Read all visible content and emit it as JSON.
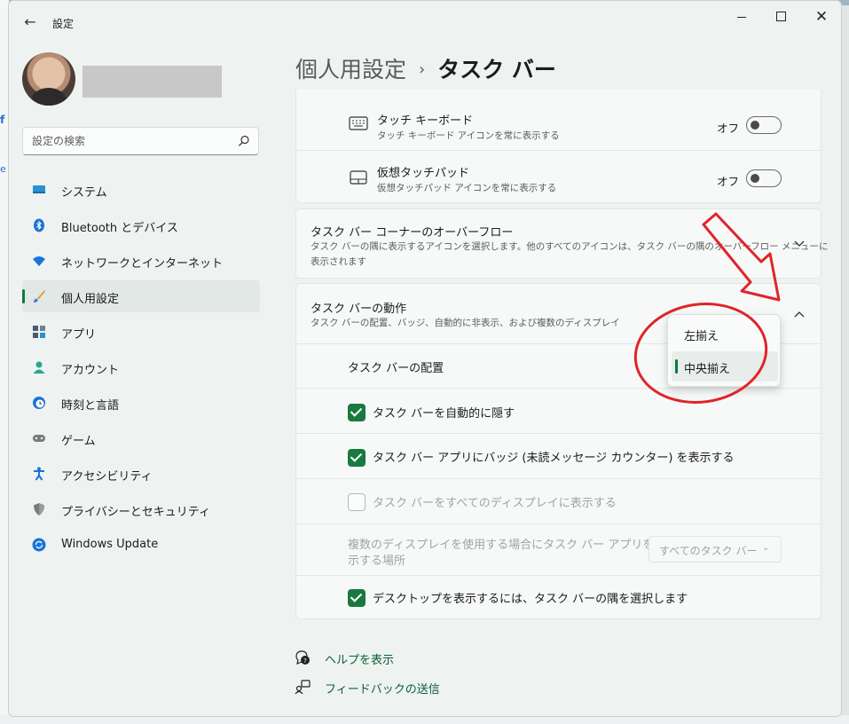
{
  "window": {
    "title": "設定",
    "back_icon": "←",
    "close_icon": "✕"
  },
  "sidebar": {
    "search_placeholder": "設定の検索",
    "items": [
      {
        "label": "システム",
        "icon": "system-icon",
        "color": "#2a8fd4"
      },
      {
        "label": "Bluetooth とデバイス",
        "icon": "bluetooth-icon",
        "color": "#1a73d8"
      },
      {
        "label": "ネットワークとインターネット",
        "icon": "wifi-icon",
        "color": "#1a73d8"
      },
      {
        "label": "個人用設定",
        "icon": "brush-icon",
        "color": "#d9822b",
        "active": true
      },
      {
        "label": "アプリ",
        "icon": "apps-icon",
        "color": "#4a5a70"
      },
      {
        "label": "アカウント",
        "icon": "account-icon",
        "color": "#2ca58d"
      },
      {
        "label": "時刻と言語",
        "icon": "globe-clock-icon",
        "color": "#1a73d8"
      },
      {
        "label": "ゲーム",
        "icon": "gamepad-icon",
        "color": "#6a6a6a"
      },
      {
        "label": "アクセシビリティ",
        "icon": "accessibility-icon",
        "color": "#1a73d8"
      },
      {
        "label": "プライバシーとセキュリティ",
        "icon": "shield-icon",
        "color": "#6a6a6a"
      },
      {
        "label": "Windows Update",
        "icon": "update-icon",
        "color": "#1a73d8"
      }
    ]
  },
  "breadcrumb": {
    "parent": "個人用設定",
    "separator": "›",
    "current": "タスク バー"
  },
  "icons_card": {
    "rows": [
      {
        "title": "タッチ キーボード",
        "subtitle": "タッチ キーボード アイコンを常に表示する",
        "state": "オフ",
        "icon": "keyboard-icon"
      },
      {
        "title": "仮想タッチパッド",
        "subtitle": "仮想タッチパッド アイコンを常に表示する",
        "state": "オフ",
        "icon": "touchpad-icon"
      }
    ]
  },
  "overflow_card": {
    "title": "タスク バー コーナーのオーバーフロー",
    "subtitle_line1": "タスク バーの隅に表示するアイコンを選択します。他のすべてのアイコンは、タスク バーの隅のオーバーフロー メニューに",
    "subtitle_line2": "表示されます",
    "chevron": "⌄"
  },
  "behavior_card": {
    "title": "タスク バーの動作",
    "subtitle": "タスク バーの配置、バッジ、自動的に非表示、および複数のディスプレイ",
    "chevron": "︿",
    "alignment_label": "タスク バーの配置",
    "checks": [
      {
        "label": "タスク バーを自動的に隠す",
        "checked": true,
        "enabled": true
      },
      {
        "label": "タスク バー アプリにバッジ (未読メッセージ カウンター) を表示する",
        "checked": true,
        "enabled": true
      },
      {
        "label": "タスク バーをすべてのディスプレイに表示する",
        "checked": false,
        "enabled": false
      }
    ],
    "multi_display_label_line1": "複数のディスプレイを使用する場合にタスク バー アプリを表",
    "multi_display_label_line2": "示する場所",
    "multi_display_select": "すべてのタスク バー",
    "multi_display_chevron": "⌄",
    "desktop_corner": {
      "label": "デスクトップを表示するには、タスク バーの隅を選択します",
      "checked": true
    }
  },
  "alignment_dropdown": {
    "options": [
      "左揃え",
      "中央揃え"
    ],
    "selected": "中央揃え"
  },
  "links": {
    "help": "ヘルプを表示",
    "feedback": "フィードバックの送信"
  },
  "colors": {
    "accent": "#187a3f",
    "annotation": "#e0242a"
  }
}
